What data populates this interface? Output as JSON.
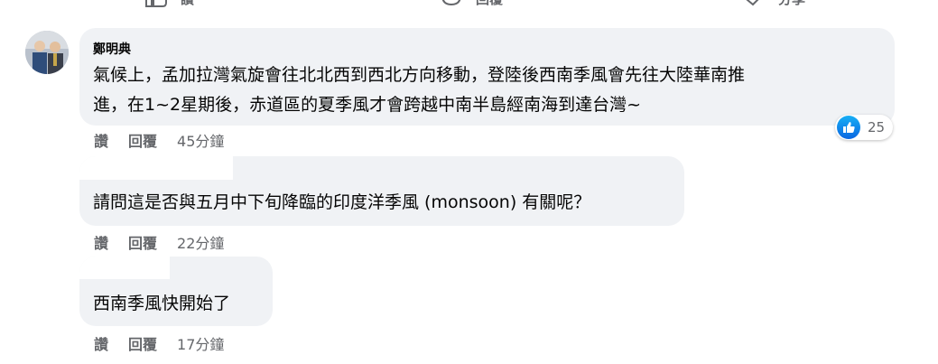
{
  "top_actions": [
    {
      "label": "讚",
      "icon": "like-icon"
    },
    {
      "label": "回覆",
      "icon": "comment-icon"
    },
    {
      "label": "分享",
      "icon": "share-icon"
    }
  ],
  "comments": [
    {
      "author": "鄭明典",
      "text_lines": [
        "氣候上，孟加拉灣氣旋會往北北西到西北方向移動，登陸後西南季風會先往大陸華南推",
        "進，在1~2星期後，赤道區的夏季風才會跨越中南半島經南海到達台灣~"
      ],
      "like_label": "讚",
      "reply_label": "回覆",
      "time": "45分鐘",
      "reaction_count": "25",
      "reaction_icon": "like-icon"
    },
    {
      "author": "",
      "text_lines": [
        "請問這是否與五月中下旬降臨的印度洋季風 (monsoon) 有關呢？"
      ],
      "like_label": "讚",
      "reply_label": "回覆",
      "time": "22分鐘"
    },
    {
      "author": "",
      "text_lines": [
        "西南季風快開始了"
      ],
      "like_label": "讚",
      "reply_label": "回覆",
      "time": "17分鐘"
    }
  ],
  "colors": {
    "bubble": "#f0f2f5",
    "secondary_text": "#65676b",
    "like_blue": "#0a66e1"
  }
}
